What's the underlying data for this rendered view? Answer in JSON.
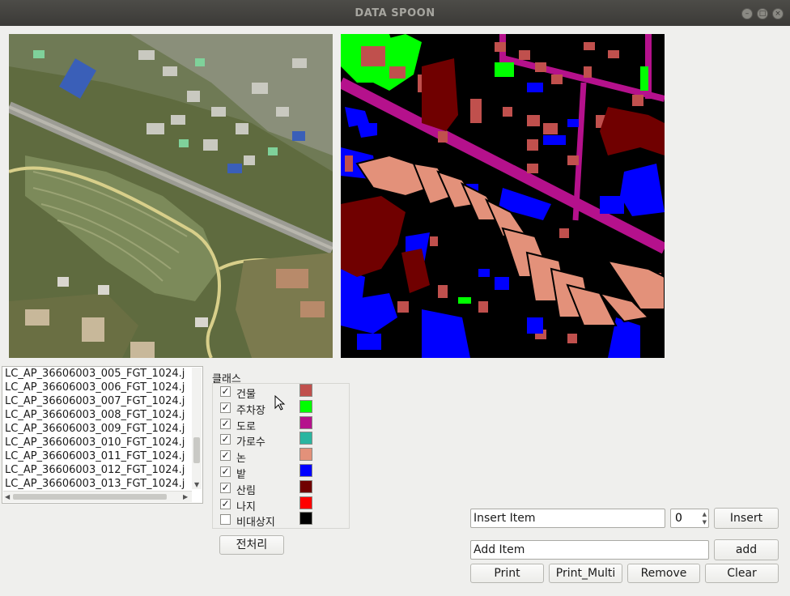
{
  "window": {
    "title": "DATA SPOON"
  },
  "files": [
    "LC_AP_36606003_005_FGT_1024.j",
    "LC_AP_36606003_006_FGT_1024.j",
    "LC_AP_36606003_007_FGT_1024.j",
    "LC_AP_36606003_008_FGT_1024.j",
    "LC_AP_36606003_009_FGT_1024.j",
    "LC_AP_36606003_010_FGT_1024.j",
    "LC_AP_36606003_011_FGT_1024.j",
    "LC_AP_36606003_012_FGT_1024.j",
    "LC_AP_36606003_013_FGT_1024.j"
  ],
  "classes": {
    "group_label": "클래스",
    "items": [
      {
        "label": "건물",
        "checked": true,
        "color": "#c0504d"
      },
      {
        "label": "주차장",
        "checked": true,
        "color": "#00ff00"
      },
      {
        "label": "도로",
        "checked": true,
        "color": "#b5118c"
      },
      {
        "label": "가로수",
        "checked": true,
        "color": "#2ab5a0"
      },
      {
        "label": "논",
        "checked": true,
        "color": "#e3917a"
      },
      {
        "label": "밭",
        "checked": true,
        "color": "#0000ff"
      },
      {
        "label": "산림",
        "checked": true,
        "color": "#700000"
      },
      {
        "label": "나지",
        "checked": true,
        "color": "#ff0000"
      },
      {
        "label": "비대상지",
        "checked": false,
        "color": "#000000"
      }
    ]
  },
  "preprocess_button": "전처리",
  "insert": {
    "value": "Insert Item",
    "spin_value": "0",
    "button": "Insert"
  },
  "add": {
    "value": "Add Item",
    "button": "add"
  },
  "actions": {
    "print": "Print",
    "print_multi": "Print_Multi",
    "remove": "Remove",
    "clear": "Clear"
  }
}
